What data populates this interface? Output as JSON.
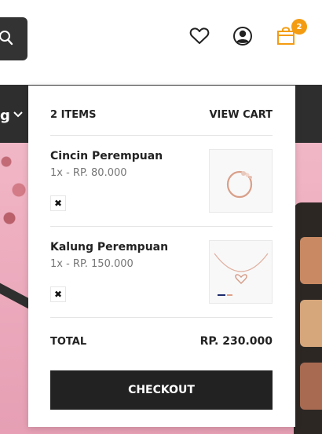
{
  "header": {
    "cart_count": "2"
  },
  "nav": {
    "fragment_label": "g"
  },
  "minicart": {
    "items_count_label": "2 ITEMS",
    "view_cart_label": "VIEW CART",
    "items": [
      {
        "name": "Cincin Perempuan",
        "qty_price": "1x - RP. 80.000",
        "remove_glyph": "✖"
      },
      {
        "name": "Kalung Perempuan",
        "qty_price": "1x - RP. 150.000",
        "remove_glyph": "✖"
      }
    ],
    "total_label": "TOTAL",
    "total_value": "RP. 230.000",
    "checkout_label": "CHECKOUT"
  },
  "colors": {
    "accent": "#f39c12",
    "dark": "#222222",
    "hero_pink": "#ecaabd"
  },
  "icons": [
    "search-icon",
    "heart-icon",
    "user-icon",
    "cart-icon",
    "chevron-down-icon",
    "close-icon"
  ]
}
